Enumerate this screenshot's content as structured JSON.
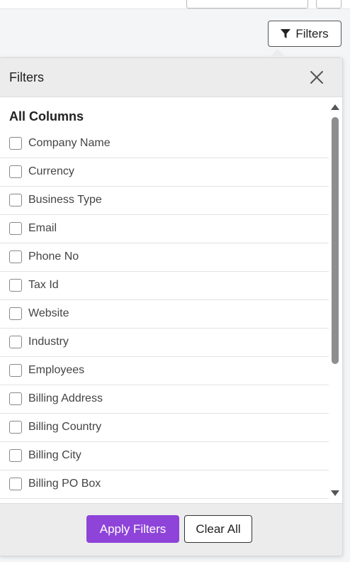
{
  "toolbar": {
    "filters_button_label": "Filters"
  },
  "panel": {
    "title": "Filters",
    "section_title": "All Columns",
    "columns": [
      {
        "label": "Company Name",
        "checked": false
      },
      {
        "label": "Currency",
        "checked": false
      },
      {
        "label": "Business Type",
        "checked": false
      },
      {
        "label": "Email",
        "checked": false
      },
      {
        "label": "Phone No",
        "checked": false
      },
      {
        "label": "Tax Id",
        "checked": false
      },
      {
        "label": "Website",
        "checked": false
      },
      {
        "label": "Industry",
        "checked": false
      },
      {
        "label": "Employees",
        "checked": false
      },
      {
        "label": "Billing Address",
        "checked": false
      },
      {
        "label": "Billing Country",
        "checked": false
      },
      {
        "label": "Billing City",
        "checked": false
      },
      {
        "label": "Billing PO Box",
        "checked": false
      }
    ]
  },
  "footer": {
    "apply_label": "Apply Filters",
    "clear_label": "Clear All"
  },
  "colors": {
    "accent": "#8e44d9",
    "header_bg": "#ececec"
  }
}
